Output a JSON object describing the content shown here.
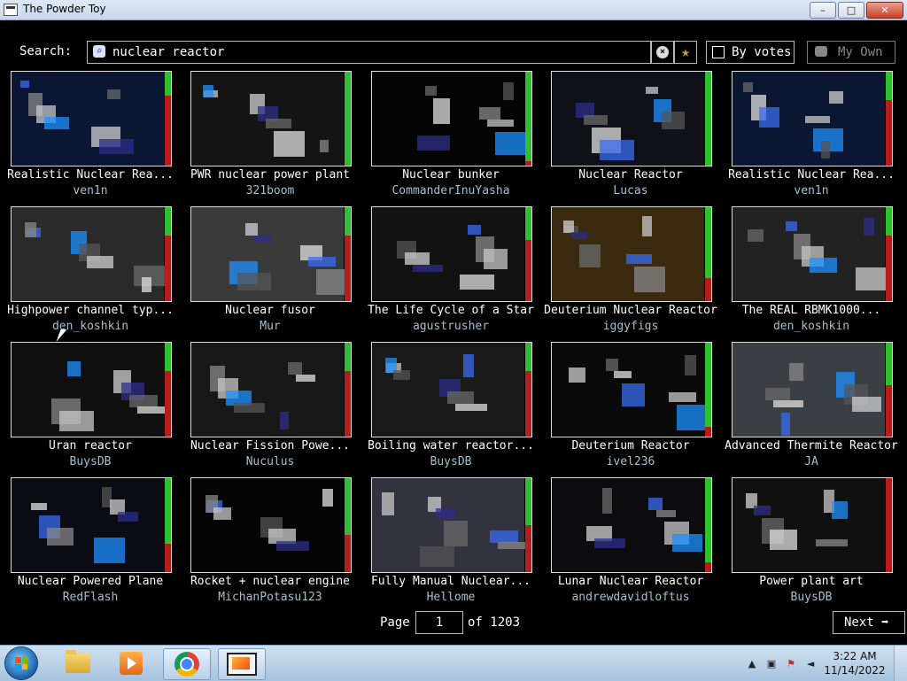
{
  "window": {
    "title": "The Powder Toy",
    "min": "–",
    "max": "□",
    "close": "✕"
  },
  "search": {
    "label": "Search:",
    "value": "nuclear reactor",
    "clear_icon": "×",
    "fav_icon": "★"
  },
  "sort_button": {
    "label": "By votes"
  },
  "my_own_button": {
    "label": "My Own"
  },
  "saves": [
    {
      "title": "Realistic Nuclear Rea...",
      "author": "ven1n",
      "vote_up_fraction": 0.25,
      "theme": "#0b1633"
    },
    {
      "title": "PWR nuclear power plant",
      "author": "321boom",
      "vote_up_fraction": 1.0,
      "theme": "#141414"
    },
    {
      "title": "Nuclear bunker",
      "author": "CommanderInuYasha",
      "vote_up_fraction": 0.95,
      "theme": "#050505"
    },
    {
      "title": "Nuclear Reactor",
      "author": "Lucas",
      "vote_up_fraction": 1.0,
      "theme": "#101018"
    },
    {
      "title": "Realistic Nuclear Rea...",
      "author": "ven1n",
      "vote_up_fraction": 0.3,
      "theme": "#0b1633"
    },
    {
      "title": "Highpower channel typ...",
      "author": "den_koshkin",
      "vote_up_fraction": 0.3,
      "theme": "#2a2a2a"
    },
    {
      "title": "Nuclear fusor",
      "author": "Mur",
      "vote_up_fraction": 0.3,
      "theme": "#3a3a3a"
    },
    {
      "title": "The Life Cycle of a Star",
      "author": "agustrusher",
      "vote_up_fraction": 0.35,
      "theme": "#121212"
    },
    {
      "title": "Deuterium Nuclear Reactor",
      "author": "iggyfigs",
      "vote_up_fraction": 0.75,
      "theme": "#3a2a10"
    },
    {
      "title": "The REAL RBMK1000...",
      "author": "den_koshkin",
      "vote_up_fraction": 0.3,
      "theme": "#222"
    },
    {
      "title": "Uran reactor",
      "author": "BuysDB",
      "vote_up_fraction": 0.3,
      "theme": "#101010"
    },
    {
      "title": "Nuclear Fission Powe...",
      "author": "Nuculus",
      "vote_up_fraction": 0.3,
      "theme": "#181818"
    },
    {
      "title": "Boiling water reactor...",
      "author": "BuysDB",
      "vote_up_fraction": 0.3,
      "theme": "#1a1a1a"
    },
    {
      "title": "Deuterium Reactor",
      "author": "ivel236",
      "vote_up_fraction": 0.9,
      "theme": "#0a0a0a"
    },
    {
      "title": "Advanced Thermite Reactor",
      "author": "JA",
      "vote_up_fraction": 0.45,
      "theme": "#3a3f44"
    },
    {
      "title": "Nuclear Powered Plane",
      "author": "RedFlash",
      "vote_up_fraction": 0.7,
      "theme": "#0b0b14"
    },
    {
      "title": "Rocket + nuclear engine",
      "author": "MichanPotasu123",
      "vote_up_fraction": 0.6,
      "theme": "#050505"
    },
    {
      "title": "Fully Manual Nuclear...",
      "author": "Hellome",
      "vote_up_fraction": 0.5,
      "theme": "#333340"
    },
    {
      "title": "Lunar Nuclear Reactor",
      "author": "andrewdavidloftus",
      "vote_up_fraction": 0.9,
      "theme": "#0c0c10"
    },
    {
      "title": "Power plant art",
      "author": "BuysDB",
      "vote_up_fraction": 0.0,
      "theme": "#101010"
    }
  ],
  "pagination": {
    "label": "Page",
    "current": "1",
    "of_label": "of",
    "total": "1203",
    "next_label": "Next",
    "next_icon": "➡"
  },
  "taskbar": {
    "apps": [
      "file-explorer",
      "media-player",
      "chrome",
      "powder-toy"
    ],
    "clock_time": "3:22 AM",
    "clock_date": "11/14/2022",
    "tray_icons": [
      "up-arrow",
      "network",
      "flag",
      "volume"
    ]
  }
}
